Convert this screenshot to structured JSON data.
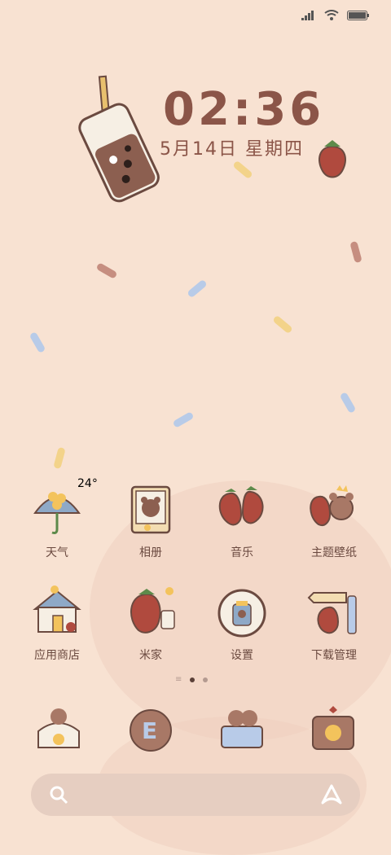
{
  "clock": {
    "time": "02:36",
    "date": "5月14日 星期四"
  },
  "weather_widget": {
    "temp": "24°"
  },
  "apps_row1": [
    {
      "label": "天气",
      "icon": "umbrella-icon"
    },
    {
      "label": "相册",
      "icon": "bear-photo-icon"
    },
    {
      "label": "音乐",
      "icon": "strawberry-icon"
    },
    {
      "label": "主题壁纸",
      "icon": "bear-strawberry-icon"
    }
  ],
  "apps_row2": [
    {
      "label": "应用商店",
      "icon": "house-icon"
    },
    {
      "label": "米家",
      "icon": "strawberry-jar-icon"
    },
    {
      "label": "设置",
      "icon": "jar-plate-icon"
    },
    {
      "label": "下载管理",
      "icon": "sign-strawberry-icon"
    }
  ],
  "dock": [
    {
      "icon": "phone-bear-icon"
    },
    {
      "icon": "letter-e-icon"
    },
    {
      "icon": "bear-message-icon"
    },
    {
      "icon": "camera-icon"
    }
  ],
  "search": {
    "icon": "search-icon",
    "assistant_icon": "assistant-icon"
  },
  "colors": {
    "background": "#f8e2d2",
    "text": "#8b5548",
    "label": "#6b4a40"
  }
}
